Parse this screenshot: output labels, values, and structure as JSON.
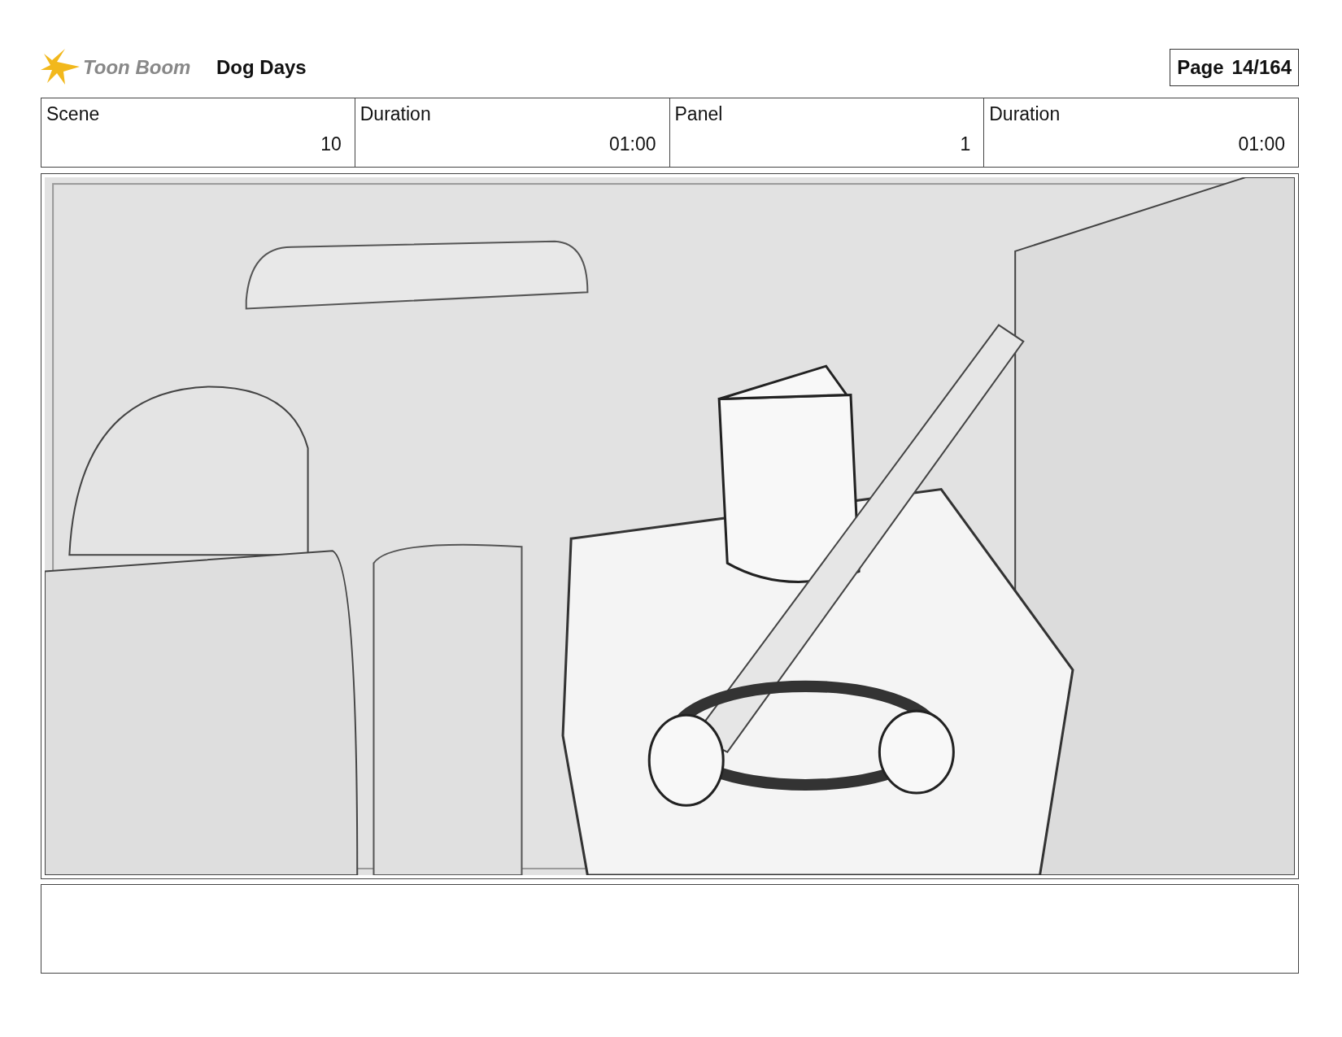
{
  "header": {
    "logo_text": "Toon Boom",
    "project_title": "Dog Days",
    "page_label": "Page",
    "page_number": "14/164"
  },
  "info": [
    {
      "label": "Scene",
      "value": "10"
    },
    {
      "label": "Duration",
      "value": "01:00"
    },
    {
      "label": "Panel",
      "value": "1"
    },
    {
      "label": "Duration",
      "value": "01:00"
    }
  ]
}
